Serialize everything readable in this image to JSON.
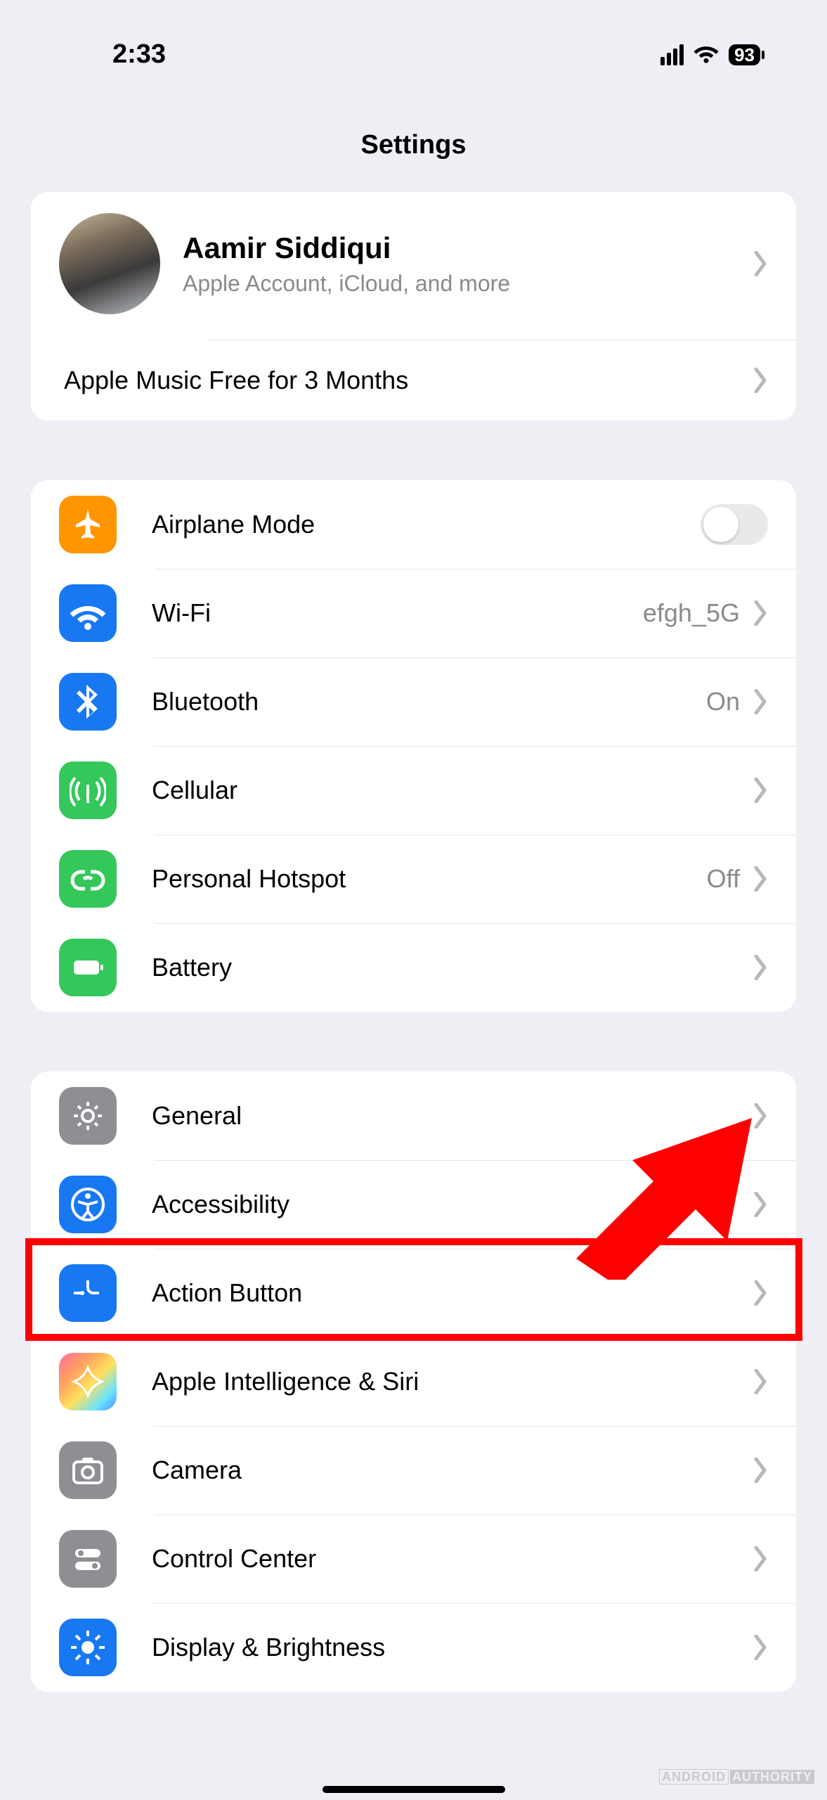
{
  "status": {
    "time": "2:33",
    "battery": "93"
  },
  "title": "Settings",
  "profile": {
    "name": "Aamir Siddiqui",
    "subtitle": "Apple Account, iCloud, and more",
    "promo": "Apple Music Free for 3 Months"
  },
  "group1": [
    {
      "id": "airplane",
      "label": "Airplane Mode",
      "icon": "airplane-icon",
      "color": "ic-orange",
      "toggle": false
    },
    {
      "id": "wifi",
      "label": "Wi-Fi",
      "icon": "wifi-icon",
      "color": "ic-blue",
      "value": "efgh_5G"
    },
    {
      "id": "bluetooth",
      "label": "Bluetooth",
      "icon": "bluetooth-icon",
      "color": "ic-blue",
      "value": "On"
    },
    {
      "id": "cellular",
      "label": "Cellular",
      "icon": "cellular-icon",
      "color": "ic-green"
    },
    {
      "id": "hotspot",
      "label": "Personal Hotspot",
      "icon": "hotspot-icon",
      "color": "ic-green",
      "value": "Off"
    },
    {
      "id": "battery",
      "label": "Battery",
      "icon": "battery-icon",
      "color": "ic-green"
    }
  ],
  "group2": [
    {
      "id": "general",
      "label": "General",
      "icon": "gear-icon",
      "color": "ic-gray"
    },
    {
      "id": "accessibility",
      "label": "Accessibility",
      "icon": "accessibility-icon",
      "color": "ic-blue",
      "highlight": true
    },
    {
      "id": "actionbutton",
      "label": "Action Button",
      "icon": "action-icon",
      "color": "ic-blue"
    },
    {
      "id": "ai",
      "label": "Apple Intelligence & Siri",
      "icon": "ai-icon",
      "color": "ic-rainbow"
    },
    {
      "id": "camera",
      "label": "Camera",
      "icon": "camera-icon",
      "color": "ic-gray"
    },
    {
      "id": "controlcenter",
      "label": "Control Center",
      "icon": "control-icon",
      "color": "ic-gray"
    },
    {
      "id": "display",
      "label": "Display & Brightness",
      "icon": "brightness-icon",
      "color": "ic-blue"
    }
  ],
  "watermark": {
    "a": "ANDROID",
    "b": "AUTHORITY"
  }
}
